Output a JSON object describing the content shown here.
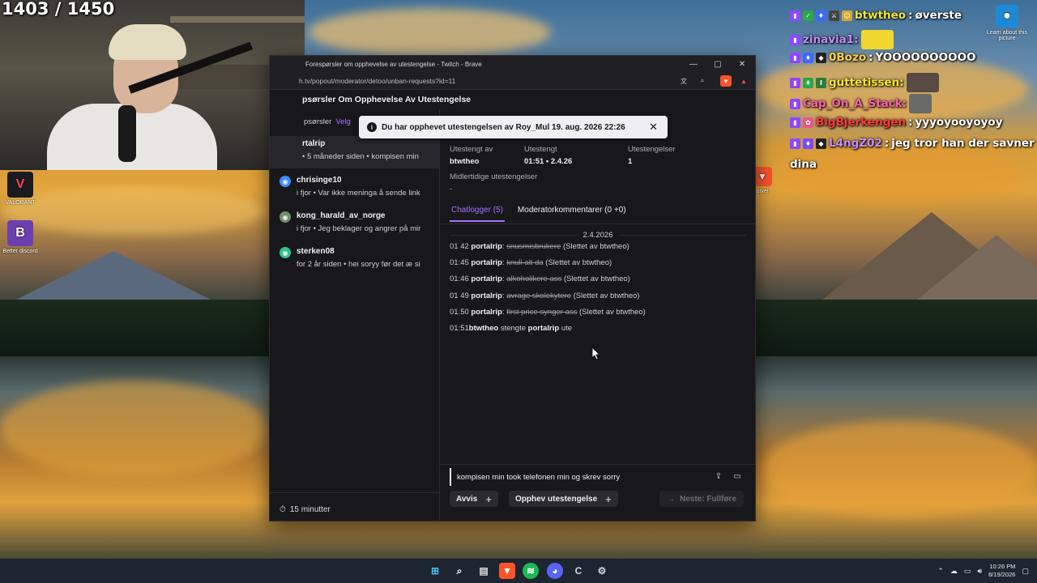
{
  "overlay": {
    "counter": "1403 / 1450"
  },
  "desktop": {
    "icons": [
      {
        "label": "VALORANT",
        "icon": "valorant-icon"
      },
      {
        "label": "Better discord",
        "icon": "betterdiscord-icon"
      }
    ],
    "learn_about": "Learn about this picture",
    "partial_icon_label": "utvei"
  },
  "browser": {
    "title": "Forespørsler om opphevelse av utestengelse - Twitch - Brave",
    "url": "h.tv/popout/moderator/detoo/unban-requests?id=11",
    "page_header": "psørsler Om Opphevelse Av Utestengelse"
  },
  "left_panel": {
    "tab_label": "psørsler",
    "tab_select": "Velg",
    "requests": [
      {
        "name": "rtalrip",
        "snippet": "• 5 måneder siden • kompisen min",
        "avatar_color": "#4c4c54",
        "selected": true
      },
      {
        "name": "chrisinge10",
        "snippet": "i fjor • Var ikke meninga å sende link",
        "avatar_color": "#3d8eff",
        "selected": false
      },
      {
        "name": "kong_harald_av_norge",
        "snippet": "i fjor • Jeg beklager og angrer på mir",
        "avatar_color": "#6d8f6a",
        "selected": false
      },
      {
        "name": "sterken08",
        "snippet": "for 2 år siden • hei soryy før det æ si",
        "avatar_color": "#2ec48b",
        "selected": false
      }
    ],
    "timer": "15 minutter"
  },
  "details": {
    "stats": [
      {
        "label": "Utestengt av",
        "value": "btwtheo"
      },
      {
        "label": "Utestengt",
        "value": "01:51 • 2.4.26"
      },
      {
        "label": "Utestengelser",
        "value": "1"
      }
    ],
    "temp_label": "Midlertidige utestengelser",
    "temp_value": "-",
    "tabs": [
      {
        "label": "Chatlogger (5)",
        "active": true
      },
      {
        "label": "Moderatorkommentarer (0 +0)",
        "active": false
      }
    ],
    "log_date": "2.4.2026",
    "logs": [
      {
        "time": "01 42",
        "user": "portalrip",
        "msg": "snusmisbrukere",
        "note": "(Slettet av btwtheo)"
      },
      {
        "time": "01:45",
        "user": "portalrip",
        "msg": "knull alt da",
        "note": "(Slettet av btwtheo)"
      },
      {
        "time": "01:46",
        "user": "portalrip",
        "msg": "alkoholikere ass",
        "note": "(Slettet av btwtheo)"
      },
      {
        "time": "01 49",
        "user": "portalrip",
        "msg": "avrage skolekytere",
        "note": "(Slettet av btwtheo)"
      },
      {
        "time": "01.50",
        "user": "portalrip",
        "msg": "first price synger ass",
        "note": "(Slettet av btwtheo)"
      }
    ],
    "ban_line": {
      "time": "01:51",
      "mod": "btwtheo",
      "action": "stengte",
      "user": "portalrip",
      "suffix": "ute"
    },
    "message": "kompisen min took telefonen min og skrev sorry",
    "buttons": {
      "deny": "Avvis",
      "unban": "Opphev utestengelse",
      "next": "Neste: Fullføre"
    }
  },
  "toast": {
    "text": "Du har opphevet utestengelsen av Roy_Mul 19. aug. 2026 22:26"
  },
  "chat": [
    {
      "user": "btwtheo",
      "color": "#f5e62c",
      "msg": "øverste"
    },
    {
      "user": "zinavia1:",
      "color": "#c58cff",
      "msg": ""
    },
    {
      "user": "0Bozo",
      "color": "#ffd24a",
      "msg": "YOOOOOOOOOO"
    },
    {
      "user": "guttetissen:",
      "color": "#f5e62c",
      "msg": ""
    },
    {
      "user": "Cap_On_A_Stack:",
      "color": "#ff5fb0",
      "msg": ""
    },
    {
      "user": "BigBjerkengen",
      "color": "#ff3b3b",
      "msg": "yyyoyooyoyoy"
    },
    {
      "user": "L4ngZ02",
      "color": "#c58cff",
      "msg": "jeg tror han der savner"
    },
    {
      "user": "",
      "color": "#ffffff",
      "msg": "dina"
    }
  ],
  "taskbar": {
    "time": "10:26 PM",
    "date": "8/19/2026"
  }
}
